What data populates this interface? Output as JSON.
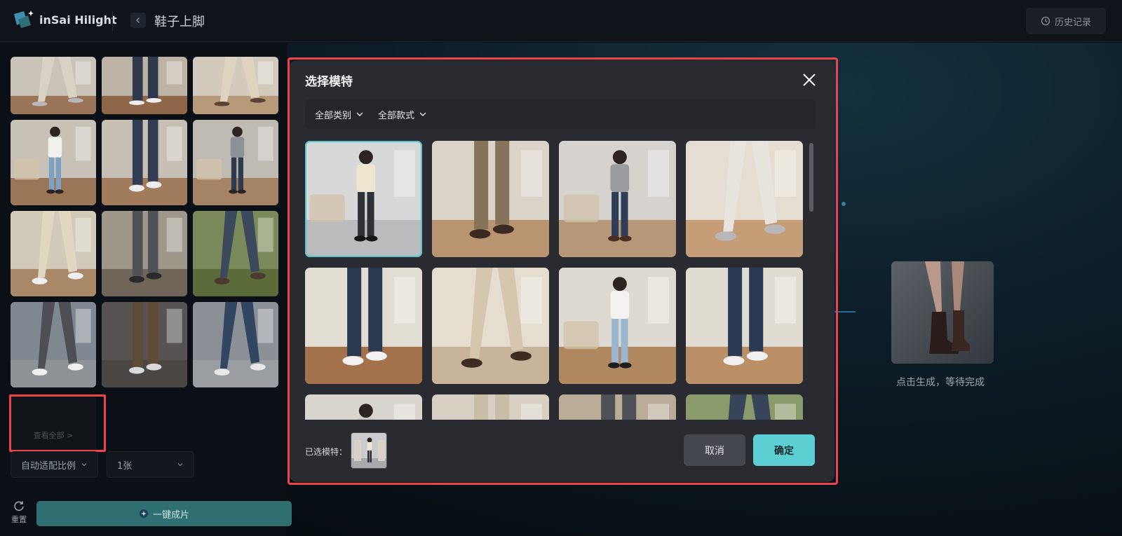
{
  "app": {
    "brand": "inSai Hilight",
    "page_title": "鞋子上脚",
    "history_button": "历史记录"
  },
  "left_panel": {
    "view_all": "查看全部 >",
    "ratio_select": "自动适配比例",
    "count_select": "1张",
    "reset_label": "重置",
    "generate_button": "一键成片"
  },
  "result": {
    "hint": "点击生成，等待完成"
  },
  "modal": {
    "title": "选择模特",
    "filters": [
      "全部类别",
      "全部款式"
    ],
    "selected_label": "已选模特：",
    "cancel_button": "取消",
    "confirm_button": "确定"
  },
  "colors": {
    "accent": "#5ccfd3",
    "highlight_border": "#ec4448"
  },
  "icons": {
    "close": "close-icon",
    "back": "chevron-left-icon",
    "history": "history-icon",
    "dropdown": "chevron-down-icon",
    "reset": "refresh-icon",
    "generate": "sparkle-icon"
  }
}
